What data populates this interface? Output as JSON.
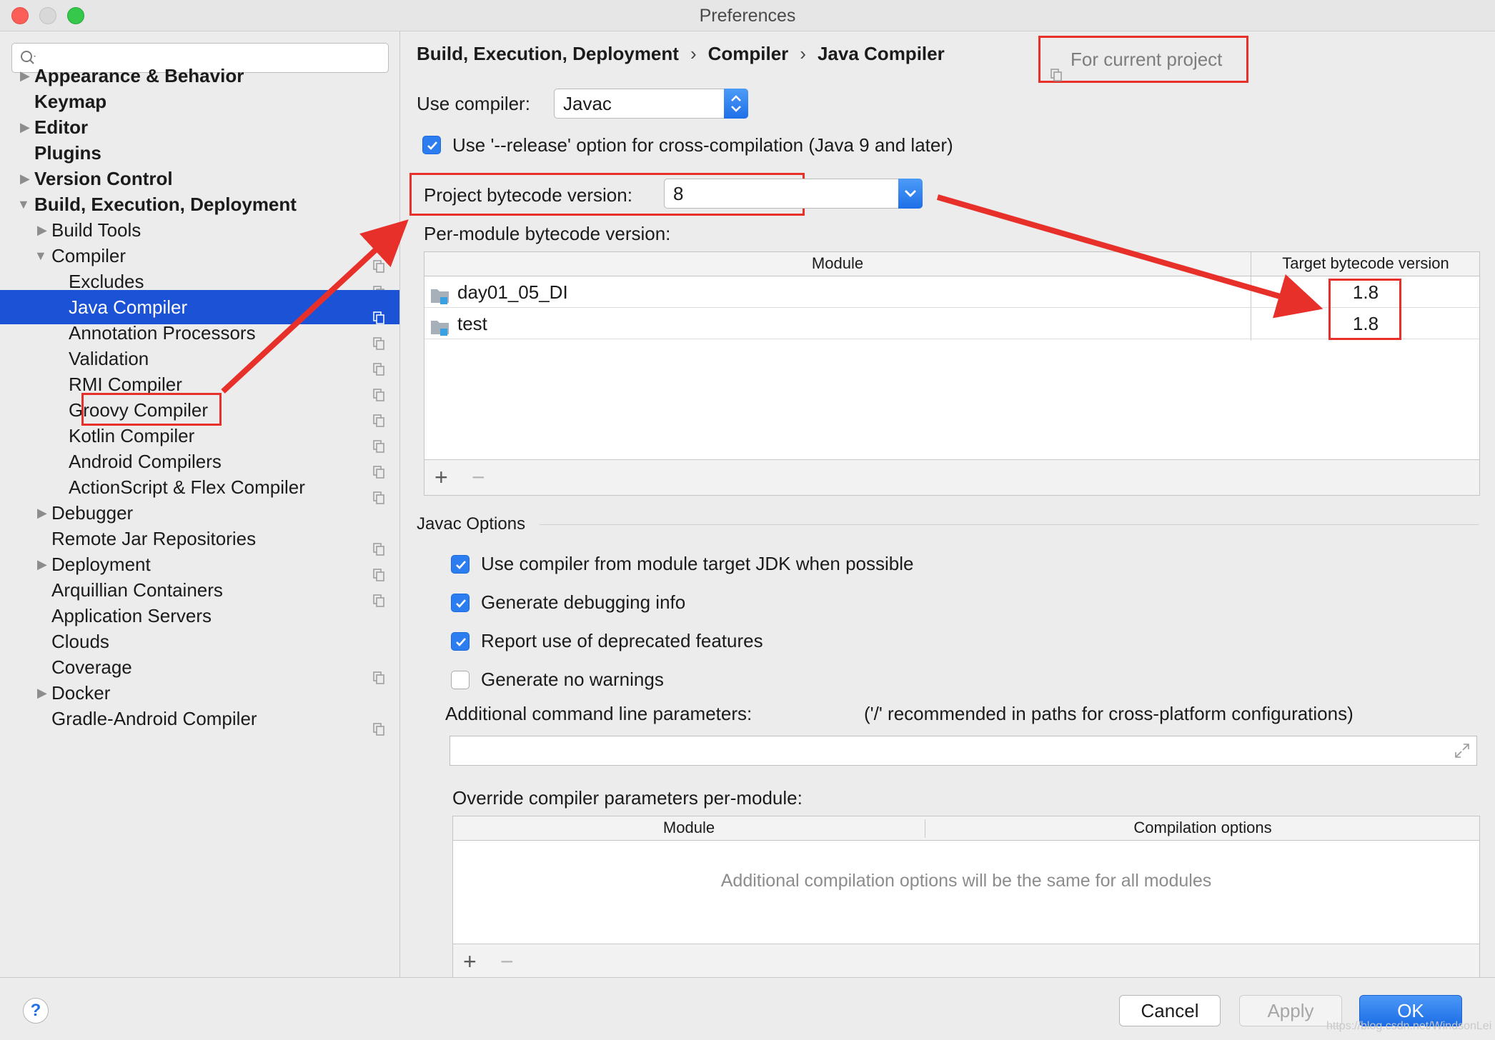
{
  "window": {
    "title": "Preferences"
  },
  "search": {
    "placeholder": ""
  },
  "sidebar": {
    "items": [
      {
        "label": "Appearance & Behavior"
      },
      {
        "label": "Keymap"
      },
      {
        "label": "Editor"
      },
      {
        "label": "Plugins"
      },
      {
        "label": "Version Control"
      },
      {
        "label": "Build, Execution, Deployment"
      },
      {
        "label": "Build Tools"
      },
      {
        "label": "Compiler"
      },
      {
        "label": "Excludes"
      },
      {
        "label": "Java Compiler"
      },
      {
        "label": "Annotation Processors"
      },
      {
        "label": "Validation"
      },
      {
        "label": "RMI Compiler"
      },
      {
        "label": "Groovy Compiler"
      },
      {
        "label": "Kotlin Compiler"
      },
      {
        "label": "Android Compilers"
      },
      {
        "label": "ActionScript & Flex Compiler"
      },
      {
        "label": "Debugger"
      },
      {
        "label": "Remote Jar Repositories"
      },
      {
        "label": "Deployment"
      },
      {
        "label": "Arquillian Containers"
      },
      {
        "label": "Application Servers"
      },
      {
        "label": "Clouds"
      },
      {
        "label": "Coverage"
      },
      {
        "label": "Docker"
      },
      {
        "label": "Gradle-Android Compiler"
      }
    ]
  },
  "breadcrumb": {
    "items": [
      "Build, Execution, Deployment",
      "Compiler",
      "Java Compiler"
    ],
    "separator": "›"
  },
  "scope": {
    "label": "For current project"
  },
  "compiler": {
    "label": "Use compiler:",
    "value": "Javac"
  },
  "release_option": {
    "label": "Use '--release' option for cross-compilation (Java 9 and later)"
  },
  "bytecode": {
    "label": "Project bytecode version:",
    "value": "8"
  },
  "per_module": {
    "label": "Per-module bytecode version:",
    "columns": [
      "Module",
      "Target bytecode version"
    ],
    "rows": [
      {
        "module": "day01_05_DI",
        "version": "1.8"
      },
      {
        "module": "test",
        "version": "1.8"
      }
    ]
  },
  "javac": {
    "section": "Javac Options",
    "options": [
      {
        "label": "Use compiler from module target JDK when possible"
      },
      {
        "label": "Generate debugging info"
      },
      {
        "label": "Report use of deprecated features"
      },
      {
        "label": "Generate no warnings"
      }
    ],
    "cmdline_label": "Additional command line parameters:",
    "cmdline_hint": "('/' recommended in paths for cross-platform configurations)",
    "cmdline_value": ""
  },
  "override": {
    "label": "Override compiler parameters per-module:",
    "columns": [
      "Module",
      "Compilation options"
    ],
    "empty_text": "Additional compilation options will be the same for all modules"
  },
  "toolbar": {
    "add": "+",
    "remove": "−"
  },
  "buttons": {
    "help": "?",
    "cancel": "Cancel",
    "apply": "Apply",
    "ok": "OK"
  },
  "watermark": "https://blog.csdn.net/WindsonLei",
  "colors": {
    "accent": "#1b52d6",
    "annotation": "#e8302b"
  }
}
